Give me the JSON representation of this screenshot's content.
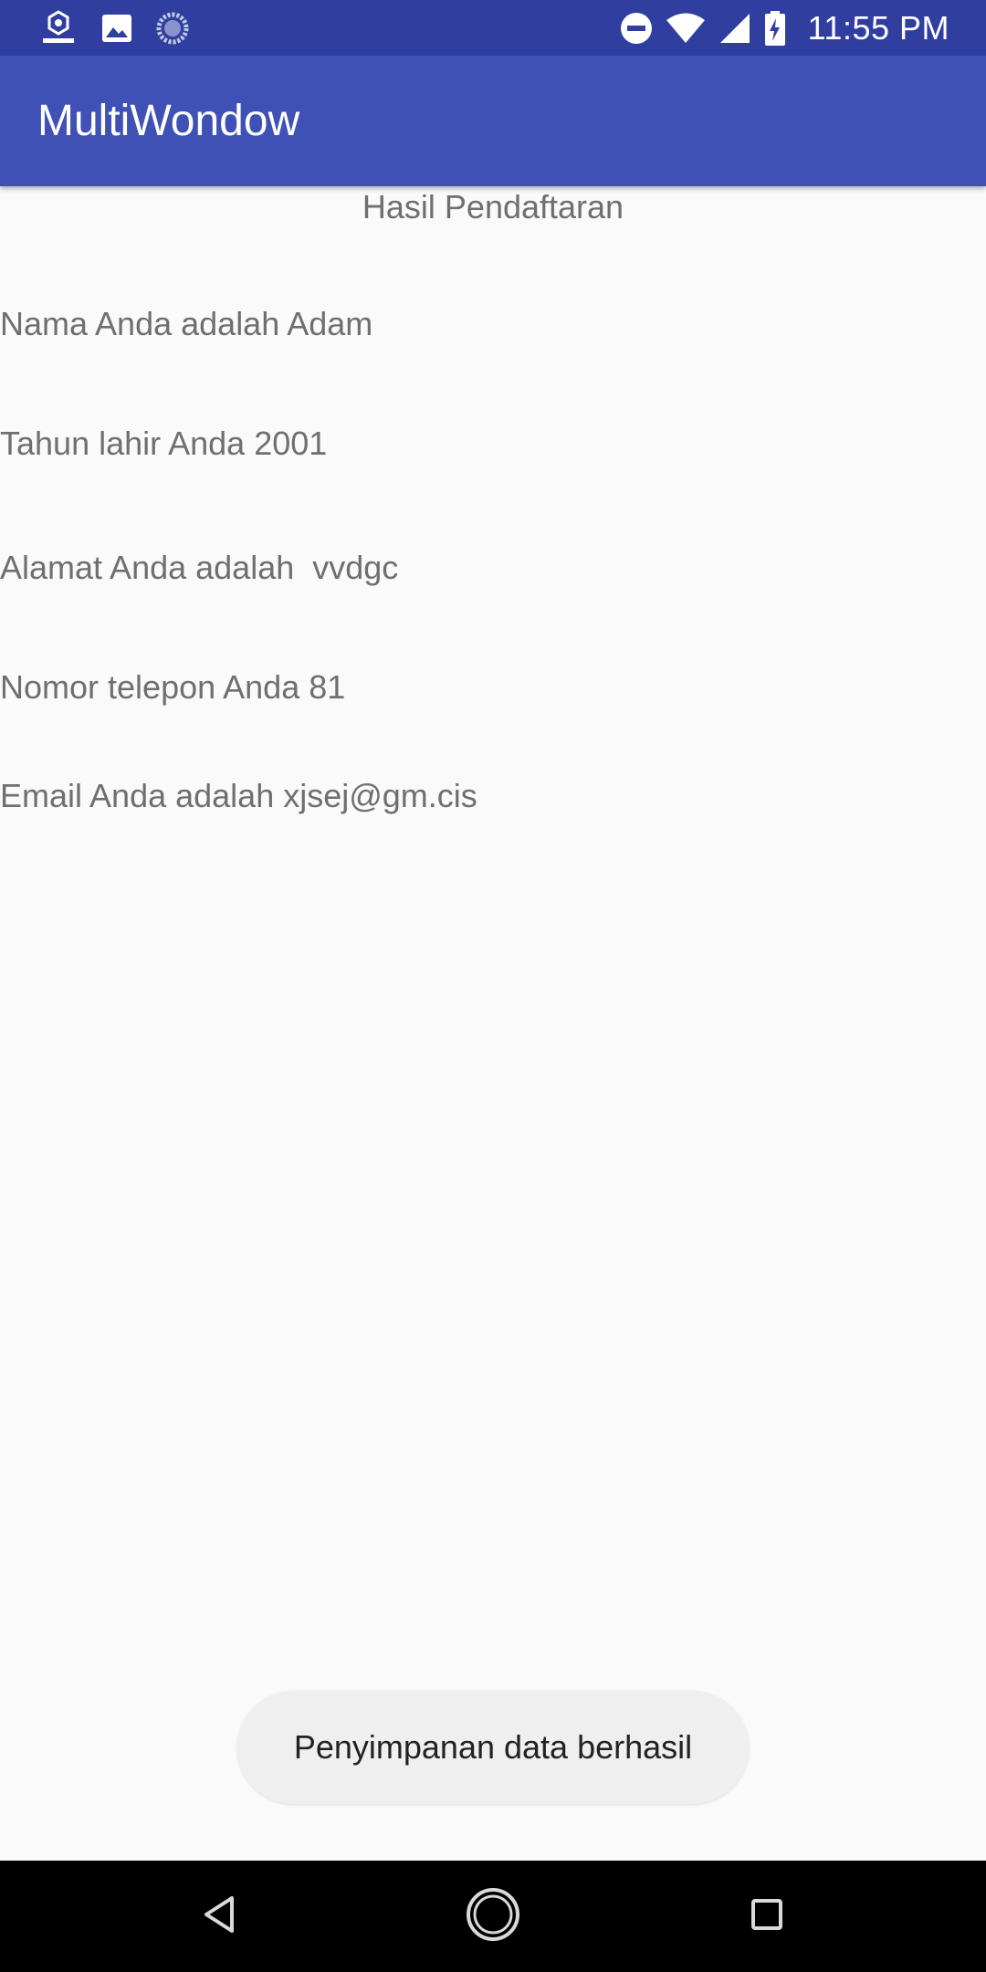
{
  "status_bar": {
    "time": "11:55 PM",
    "left_icons": [
      "app-logo-icon",
      "image-icon",
      "sync-progress-icon"
    ],
    "right_icons": [
      "do-not-disturb-icon",
      "wifi-icon",
      "cellular-signal-icon",
      "battery-charging-icon"
    ]
  },
  "app_bar": {
    "title": "MultiWondow"
  },
  "content": {
    "heading": "Hasil Pendaftaran",
    "lines": [
      "Nama Anda adalah Adam",
      "Tahun lahir Anda 2001",
      "Alamat Anda adalah  vvdgc",
      "Nomor telepon Anda 81",
      "Email Anda adalah xjsej@gm.cis"
    ]
  },
  "toast": {
    "message": "Penyimpanan data berhasil"
  },
  "nav_bar": {
    "buttons": [
      "back-icon",
      "home-icon",
      "recent-apps-icon"
    ]
  },
  "colors": {
    "status_bar": "#303f9f",
    "app_bar": "#3f51b5",
    "background": "#fafafa",
    "text": "#6f6f6f",
    "toast_bg": "#efefef"
  }
}
